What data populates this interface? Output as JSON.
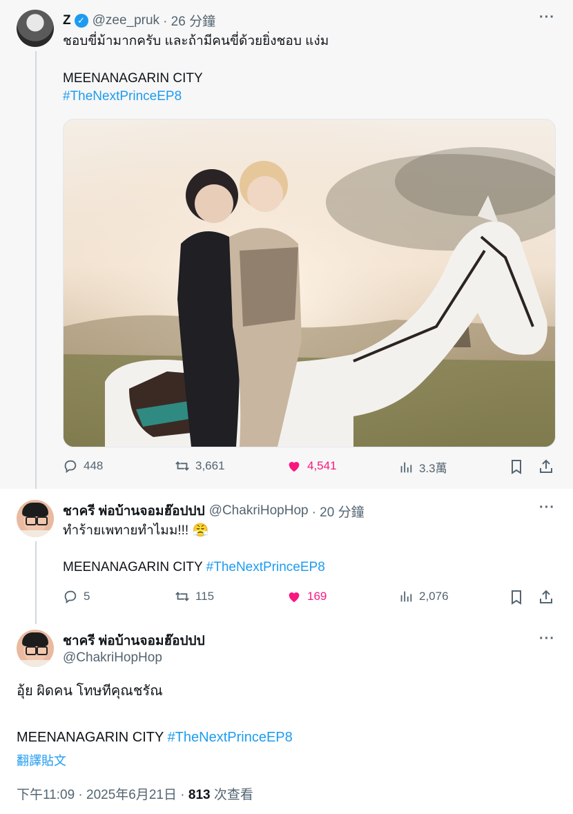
{
  "tweet1": {
    "name": "Z",
    "handle": "@zee_pruk",
    "time": "· 26 分鐘",
    "more": "···",
    "text_line1": "ชอบขี่ม้ามากครับ และถ้ามีคนขี่ด้วยยิ่งชอบ แง่ม",
    "text_line2": "MEENANAGARIN CITY",
    "hashtag": "#TheNextPrinceEP8",
    "stats": {
      "replies": "448",
      "retweets": "3,661",
      "likes": "4,541",
      "views": "3.3萬"
    }
  },
  "tweet2": {
    "name": "ชาครี พ่อบ้านจอมฮ๊อปปป",
    "handle": "@ChakriHopHop",
    "time": "· 20 分鐘",
    "more": "···",
    "text_line1": "ทำร้ายเพทายทำไมม!!! 😤",
    "text_line2": "MEENANAGARIN CITY",
    "hashtag": "#TheNextPrinceEP8",
    "stats": {
      "replies": "5",
      "retweets": "115",
      "likes": "169",
      "views": "2,076"
    }
  },
  "tweet3": {
    "name": "ชาครี พ่อบ้านจอมฮ๊อปปป",
    "handle": "@ChakriHopHop",
    "more": "···",
    "text_line1": "อุ้ย ผิดคน โทษทีคุณชรัณ",
    "text_line2": "MEENANAGARIN CITY",
    "hashtag": "#TheNextPrinceEP8",
    "translate": "翻譯貼文",
    "timestamp": "下午11:09 · 2025年6月21日 · ",
    "views_count": "813",
    "views_label": " 次查看"
  },
  "colors": {
    "accent": "#1d9bf0",
    "like": "#f91880",
    "muted": "#536471"
  }
}
